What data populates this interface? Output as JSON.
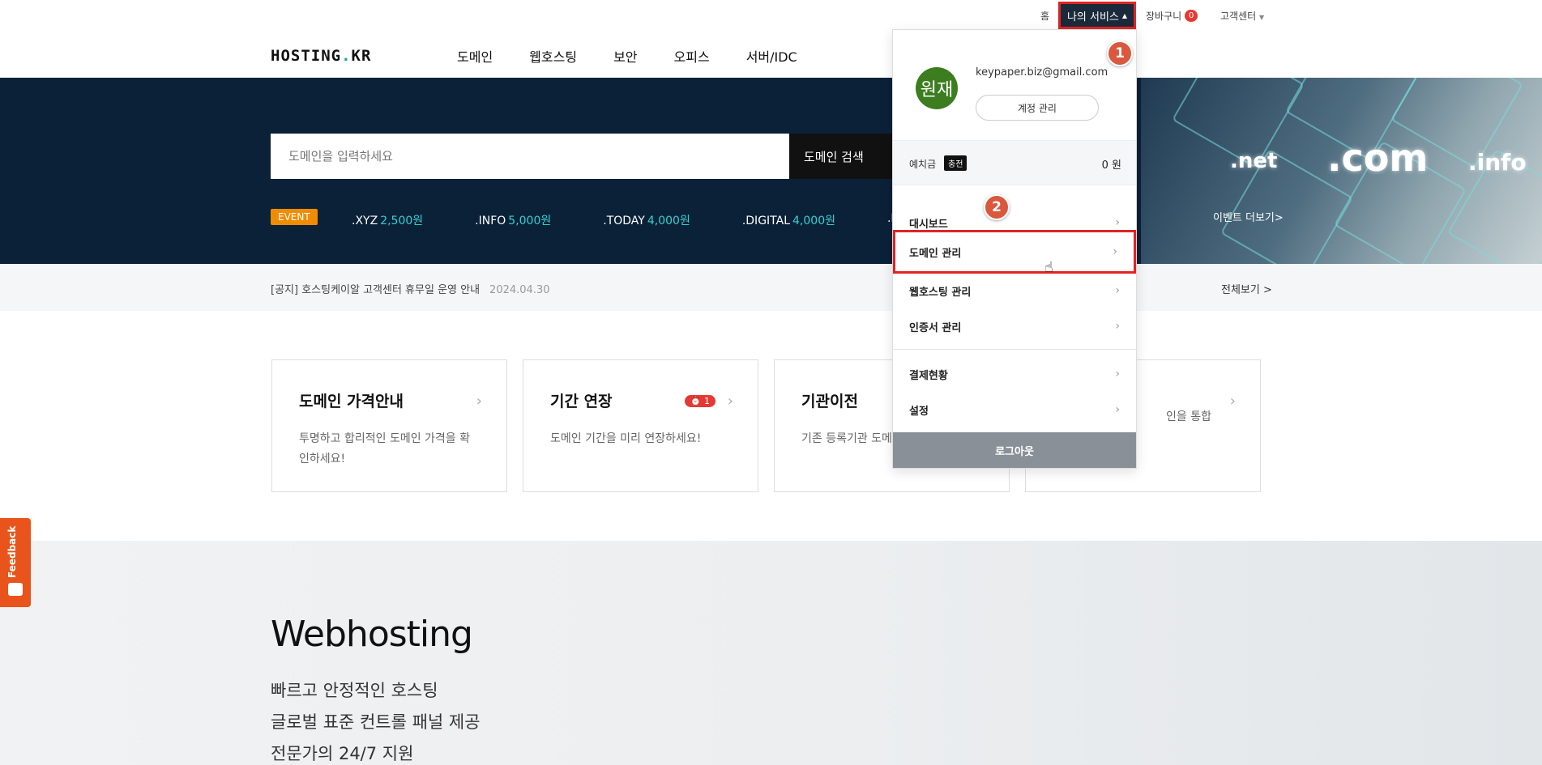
{
  "utility": {
    "home": "홈",
    "my_service": "나의 서비스",
    "cart": "장바구니",
    "cart_count": "0",
    "customer_center": "고객센터"
  },
  "header": {
    "logo_left": "HOSTING",
    "logo_dot": ".",
    "logo_right": "KR",
    "nav": [
      "도메인",
      "웹호스팅",
      "보안",
      "오피스",
      "서버/IDC"
    ]
  },
  "hero": {
    "search_placeholder": "도메인을 입력하세요",
    "search_button": "도메인 검색",
    "event_tag": "EVENT",
    "prices": [
      {
        "tld": ".XYZ",
        "price": "2,500원"
      },
      {
        "tld": ".INFO",
        "price": "5,000원"
      },
      {
        "tld": ".TODAY",
        "price": "4,000원"
      },
      {
        "tld": ".DIGITAL",
        "price": "4,000원"
      },
      {
        "tld": ".LIFE",
        "price": ""
      }
    ],
    "event_more": "이벤트 더보기>",
    "image_tlds": [
      ".net",
      ".com",
      ".info"
    ]
  },
  "notice": {
    "text": "[공지] 호스팅케이알 고객센터 휴무일 운영 안내",
    "date": "2024.04.30",
    "view_all": "전체보기 >"
  },
  "cards": [
    {
      "title": "도메인 가격안내",
      "desc": "투명하고 합리적인 도메인 가격을 확인하세요!"
    },
    {
      "title": "기간 연장",
      "desc": "도메인 기간을 미리 연장하세요!",
      "alarm": "1"
    },
    {
      "title": "기관이전",
      "desc": "기존 등록기관 도메 옮기세요!"
    },
    {
      "title": "",
      "desc": "인을 통합"
    }
  ],
  "webhosting": {
    "title": "Webhosting",
    "lines": [
      "빠르고 안정적인 호스팅",
      "글로벌 표준 컨트롤 패널 제공",
      "전문가의 24/7 지원"
    ]
  },
  "feedback": {
    "label": "Feedback"
  },
  "dropdown": {
    "avatar": "원재",
    "email": "keypaper.biz@gmail.com",
    "account_button": "계정 관리",
    "deposit_label": "예치금",
    "charge": "충전",
    "deposit_amount": "0 원",
    "items": [
      {
        "label": "대시보드"
      },
      {
        "label": "도메인 관리"
      },
      {
        "label": "웹호스팅 관리"
      },
      {
        "label": "인증서 관리"
      },
      {
        "label": "결제현황"
      },
      {
        "label": "설정"
      }
    ],
    "logout": "로그아웃"
  },
  "annotations": {
    "step1": "1",
    "step2": "2"
  },
  "colors": {
    "accent": "#14a6a8",
    "hero_bg": "#0b2138",
    "highlight": "#e02424",
    "event": "#f08c00"
  }
}
